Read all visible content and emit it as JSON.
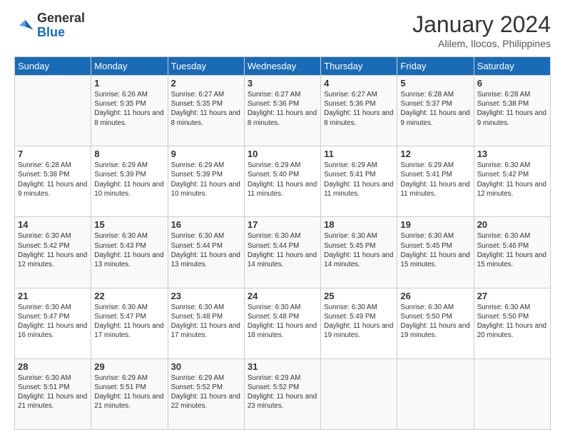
{
  "header": {
    "logo_line1": "General",
    "logo_line2": "Blue",
    "title": "January 2024",
    "subtitle": "Alilem, Ilocos, Philippines"
  },
  "columns": [
    "Sunday",
    "Monday",
    "Tuesday",
    "Wednesday",
    "Thursday",
    "Friday",
    "Saturday"
  ],
  "weeks": [
    [
      {
        "day": "",
        "sunrise": "",
        "sunset": "",
        "daylight": ""
      },
      {
        "day": "1",
        "sunrise": "6:26 AM",
        "sunset": "5:35 PM",
        "daylight": "11 hours and 8 minutes."
      },
      {
        "day": "2",
        "sunrise": "6:27 AM",
        "sunset": "5:35 PM",
        "daylight": "11 hours and 8 minutes."
      },
      {
        "day": "3",
        "sunrise": "6:27 AM",
        "sunset": "5:36 PM",
        "daylight": "11 hours and 8 minutes."
      },
      {
        "day": "4",
        "sunrise": "6:27 AM",
        "sunset": "5:36 PM",
        "daylight": "11 hours and 8 minutes."
      },
      {
        "day": "5",
        "sunrise": "6:28 AM",
        "sunset": "5:37 PM",
        "daylight": "11 hours and 9 minutes."
      },
      {
        "day": "6",
        "sunrise": "6:28 AM",
        "sunset": "5:38 PM",
        "daylight": "11 hours and 9 minutes."
      }
    ],
    [
      {
        "day": "7",
        "sunrise": "6:28 AM",
        "sunset": "5:38 PM",
        "daylight": "11 hours and 9 minutes."
      },
      {
        "day": "8",
        "sunrise": "6:29 AM",
        "sunset": "5:39 PM",
        "daylight": "11 hours and 10 minutes."
      },
      {
        "day": "9",
        "sunrise": "6:29 AM",
        "sunset": "5:39 PM",
        "daylight": "11 hours and 10 minutes."
      },
      {
        "day": "10",
        "sunrise": "6:29 AM",
        "sunset": "5:40 PM",
        "daylight": "11 hours and 11 minutes."
      },
      {
        "day": "11",
        "sunrise": "6:29 AM",
        "sunset": "5:41 PM",
        "daylight": "11 hours and 11 minutes."
      },
      {
        "day": "12",
        "sunrise": "6:29 AM",
        "sunset": "5:41 PM",
        "daylight": "11 hours and 11 minutes."
      },
      {
        "day": "13",
        "sunrise": "6:30 AM",
        "sunset": "5:42 PM",
        "daylight": "11 hours and 12 minutes."
      }
    ],
    [
      {
        "day": "14",
        "sunrise": "6:30 AM",
        "sunset": "5:42 PM",
        "daylight": "11 hours and 12 minutes."
      },
      {
        "day": "15",
        "sunrise": "6:30 AM",
        "sunset": "5:43 PM",
        "daylight": "11 hours and 13 minutes."
      },
      {
        "day": "16",
        "sunrise": "6:30 AM",
        "sunset": "5:44 PM",
        "daylight": "11 hours and 13 minutes."
      },
      {
        "day": "17",
        "sunrise": "6:30 AM",
        "sunset": "5:44 PM",
        "daylight": "11 hours and 14 minutes."
      },
      {
        "day": "18",
        "sunrise": "6:30 AM",
        "sunset": "5:45 PM",
        "daylight": "11 hours and 14 minutes."
      },
      {
        "day": "19",
        "sunrise": "6:30 AM",
        "sunset": "5:45 PM",
        "daylight": "11 hours and 15 minutes."
      },
      {
        "day": "20",
        "sunrise": "6:30 AM",
        "sunset": "5:46 PM",
        "daylight": "11 hours and 15 minutes."
      }
    ],
    [
      {
        "day": "21",
        "sunrise": "6:30 AM",
        "sunset": "5:47 PM",
        "daylight": "11 hours and 16 minutes."
      },
      {
        "day": "22",
        "sunrise": "6:30 AM",
        "sunset": "5:47 PM",
        "daylight": "11 hours and 17 minutes."
      },
      {
        "day": "23",
        "sunrise": "6:30 AM",
        "sunset": "5:48 PM",
        "daylight": "11 hours and 17 minutes."
      },
      {
        "day": "24",
        "sunrise": "6:30 AM",
        "sunset": "5:48 PM",
        "daylight": "11 hours and 18 minutes."
      },
      {
        "day": "25",
        "sunrise": "6:30 AM",
        "sunset": "5:49 PM",
        "daylight": "11 hours and 19 minutes."
      },
      {
        "day": "26",
        "sunrise": "6:30 AM",
        "sunset": "5:50 PM",
        "daylight": "11 hours and 19 minutes."
      },
      {
        "day": "27",
        "sunrise": "6:30 AM",
        "sunset": "5:50 PM",
        "daylight": "11 hours and 20 minutes."
      }
    ],
    [
      {
        "day": "28",
        "sunrise": "6:30 AM",
        "sunset": "5:51 PM",
        "daylight": "11 hours and 21 minutes."
      },
      {
        "day": "29",
        "sunrise": "6:29 AM",
        "sunset": "5:51 PM",
        "daylight": "11 hours and 21 minutes."
      },
      {
        "day": "30",
        "sunrise": "6:29 AM",
        "sunset": "5:52 PM",
        "daylight": "11 hours and 22 minutes."
      },
      {
        "day": "31",
        "sunrise": "6:29 AM",
        "sunset": "5:52 PM",
        "daylight": "11 hours and 23 minutes."
      },
      {
        "day": "",
        "sunrise": "",
        "sunset": "",
        "daylight": ""
      },
      {
        "day": "",
        "sunrise": "",
        "sunset": "",
        "daylight": ""
      },
      {
        "day": "",
        "sunrise": "",
        "sunset": "",
        "daylight": ""
      }
    ]
  ],
  "labels": {
    "sunrise_prefix": "Sunrise: ",
    "sunset_prefix": "Sunset: ",
    "daylight_prefix": "Daylight: "
  }
}
